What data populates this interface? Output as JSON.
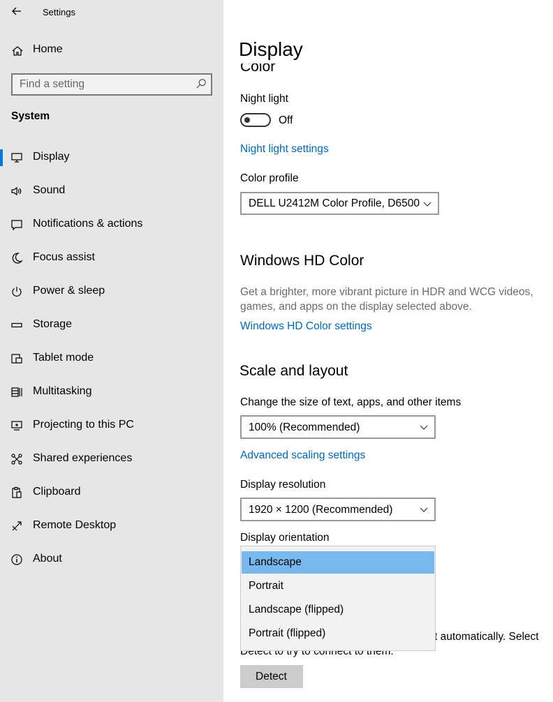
{
  "window": {
    "title": "Settings"
  },
  "sidebar": {
    "home": "Home",
    "search_placeholder": "Find a setting",
    "section": "System",
    "items": [
      {
        "label": "Display",
        "icon": "monitor-icon",
        "active": true
      },
      {
        "label": "Sound",
        "icon": "speaker-icon"
      },
      {
        "label": "Notifications & actions",
        "icon": "notification-icon"
      },
      {
        "label": "Focus assist",
        "icon": "moon-icon"
      },
      {
        "label": "Power & sleep",
        "icon": "power-icon"
      },
      {
        "label": "Storage",
        "icon": "storage-icon"
      },
      {
        "label": "Tablet mode",
        "icon": "tablet-icon"
      },
      {
        "label": "Multitasking",
        "icon": "multitasking-icon"
      },
      {
        "label": "Projecting to this PC",
        "icon": "projecting-icon"
      },
      {
        "label": "Shared experiences",
        "icon": "shared-icon"
      },
      {
        "label": "Clipboard",
        "icon": "clipboard-icon"
      },
      {
        "label": "Remote Desktop",
        "icon": "remote-desktop-icon"
      },
      {
        "label": "About",
        "icon": "info-icon"
      }
    ]
  },
  "main": {
    "title": "Display",
    "color_heading": "Color",
    "night_light": {
      "label": "Night light",
      "state": "Off"
    },
    "night_light_settings": "Night light settings",
    "color_profile": {
      "label": "Color profile",
      "value": "DELL U2412M Color Profile, D6500"
    },
    "hd_color": {
      "heading": "Windows HD Color",
      "description_line1": "Get a brighter, more vibrant picture in HDR and WCG videos,",
      "description_line2": "games, and apps on the display selected above.",
      "link": "Windows HD Color settings"
    },
    "scale": {
      "heading": "Scale and layout",
      "size_label": "Change the size of text, apps, and other items",
      "size_value": "100% (Recommended)",
      "advanced_link": "Advanced scaling settings",
      "resolution_label": "Display resolution",
      "resolution_value": "1920 × 1200 (Recommended)",
      "orientation_label": "Display orientation",
      "orientation_options": [
        "Landscape",
        "Portrait",
        "Landscape (flipped)",
        "Portrait (flipped)"
      ]
    },
    "multiple_displays": {
      "text_line1_tail": "t automatically. Select",
      "text_line2": "Detect to try to connect to them.",
      "detect_button": "Detect"
    }
  },
  "colors": {
    "accent": "#0078d7",
    "link": "#0067b8",
    "menu_selected": "#77b9ee"
  }
}
